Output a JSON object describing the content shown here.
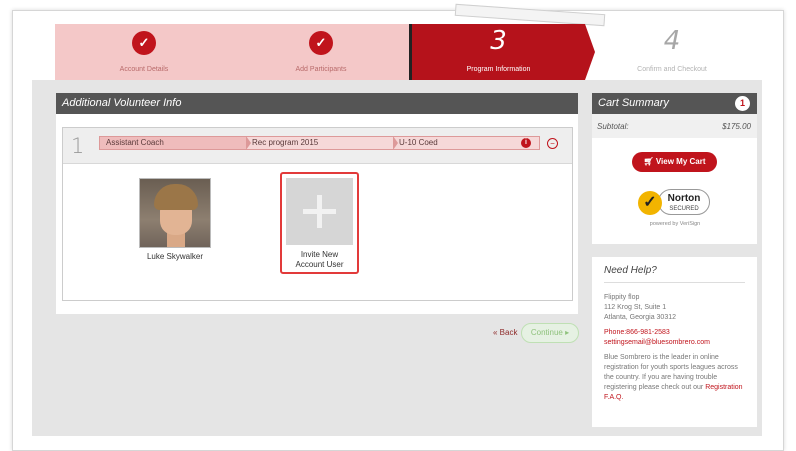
{
  "steps": [
    {
      "label": "Account Details"
    },
    {
      "label": "Add Participants"
    },
    {
      "number": "3",
      "label": "Program Information"
    },
    {
      "number": "4",
      "label": "Confirm and Checkout"
    }
  ],
  "main": {
    "panel_title": "Additional Volunteer Info",
    "row_number": "1",
    "crumbs": [
      "Assistant Coach",
      "Rec program 2015",
      "U-10 Coed"
    ],
    "person_name": "Luke Skywalker",
    "invite_label_1": "Invite New",
    "invite_label_2": "Account User",
    "back_label": "« Back",
    "continue_label": "Continue ▸"
  },
  "cart": {
    "title": "Cart Summary",
    "count": "1",
    "subtotal_label": "Subtotal:",
    "subtotal_value": "$175.00",
    "view_cart_label": "View My Cart",
    "norton_brand": "Norton",
    "norton_secured": "SECURED",
    "norton_powered": "powered by VeriSign"
  },
  "help": {
    "title": "Need Help?",
    "org_name": "Flippity flop",
    "address_1": "112 Krog St, Suite 1",
    "address_2": "Atlanta, Georgia 30312",
    "phone": "Phone:866-981-2583",
    "email": "settingsemail@bluesombrero.com",
    "blurb": "Blue Sombrero is the leader in online registration for youth sports leagues across the country. If you are having trouble registering please check out our",
    "faq_link": "Registration F.A.Q."
  },
  "colors": {
    "accent": "#b5121b",
    "header_grey": "#555555",
    "continue_green": "#8fc27c"
  }
}
